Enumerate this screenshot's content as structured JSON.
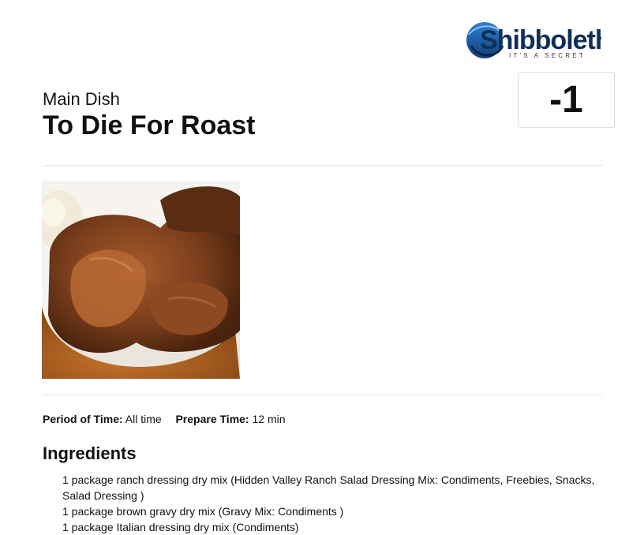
{
  "logo": {
    "name": "Shibboleth",
    "tagline": "IT'S A SECRET"
  },
  "score": "-1",
  "recipe": {
    "category": "Main Dish",
    "title": "To Die For Roast"
  },
  "meta": {
    "period_label": "Period of Time:",
    "period_value": "All time",
    "prep_label": "Prepare Time:",
    "prep_value": "12 min"
  },
  "ingredients": {
    "heading": "Ingredients",
    "items": [
      "1 package ranch dressing dry mix (Hidden Valley Ranch Salad Dressing Mix: Condiments, Freebies, Snacks, Salad Dressing )",
      "1 package brown gravy dry mix (Gravy Mix: Condiments )",
      "1 package Italian dressing dry mix (Condiments)"
    ]
  },
  "colors": {
    "logo_blue": "#1a5fa8",
    "logo_dark": "#0f2f57",
    "score_border": "#dcdcdc",
    "rule": "#e6e6e6"
  }
}
